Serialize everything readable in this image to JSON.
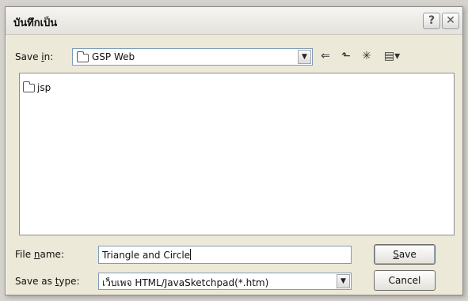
{
  "window": {
    "title": "บันทึกเป็น",
    "help_glyph": "?",
    "close_glyph": "✕"
  },
  "toolbar": {
    "save_in_label_prefix": "Save ",
    "save_in_label_mnemonic": "i",
    "save_in_label_suffix": "n:",
    "save_in_value": "GSP Web",
    "back_glyph": "⇐",
    "up_glyph": "⬑",
    "new_folder_glyph": "✳",
    "views_glyph": "▤▾"
  },
  "file_list": {
    "items": [
      {
        "label": "jsp",
        "icon": "folder-icon"
      }
    ]
  },
  "file_name": {
    "label_prefix": "File ",
    "label_mnemonic": "n",
    "label_suffix": "ame:",
    "value": "Triangle and Circle"
  },
  "save_as_type": {
    "label_prefix": "Save as ",
    "label_mnemonic": "t",
    "label_suffix": "ype:",
    "value": "เว็บเพจ HTML/JavaSketchpad(*.htm)"
  },
  "buttons": {
    "save_mnemonic": "S",
    "save_rest": "ave",
    "cancel": "Cancel"
  },
  "icons": {
    "dropdown_arrow": "▼"
  }
}
